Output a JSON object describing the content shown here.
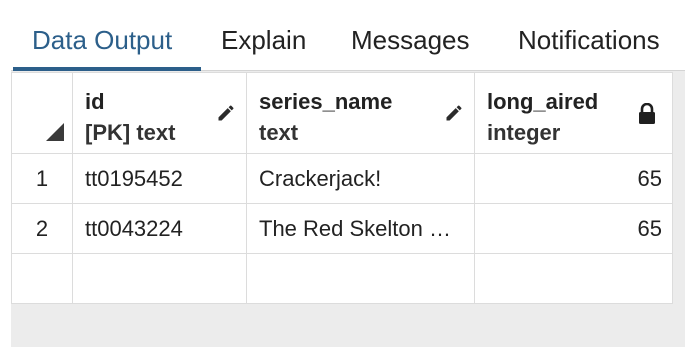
{
  "tabs": [
    {
      "label": "Data Output",
      "active": true
    },
    {
      "label": "Explain",
      "active": false
    },
    {
      "label": "Messages",
      "active": false
    },
    {
      "label": "Notifications",
      "active": false
    }
  ],
  "grid": {
    "columns": [
      {
        "name": "id",
        "type": "[PK] text",
        "icon": "pencil-icon"
      },
      {
        "name": "series_name",
        "type": "text",
        "icon": "pencil-icon"
      },
      {
        "name": "long_aired",
        "type": "integer",
        "icon": "lock-icon"
      }
    ],
    "rows": [
      {
        "num": "1",
        "id": "tt0195452",
        "series_name": "Crackerjack!",
        "long_aired": "65"
      },
      {
        "num": "2",
        "id": "tt0043224",
        "series_name": "The Red Skelton …",
        "long_aired": "65"
      }
    ]
  },
  "colors": {
    "accent": "#2c5f8a",
    "border": "#dcdcdc",
    "panel_background": "#ececec"
  }
}
